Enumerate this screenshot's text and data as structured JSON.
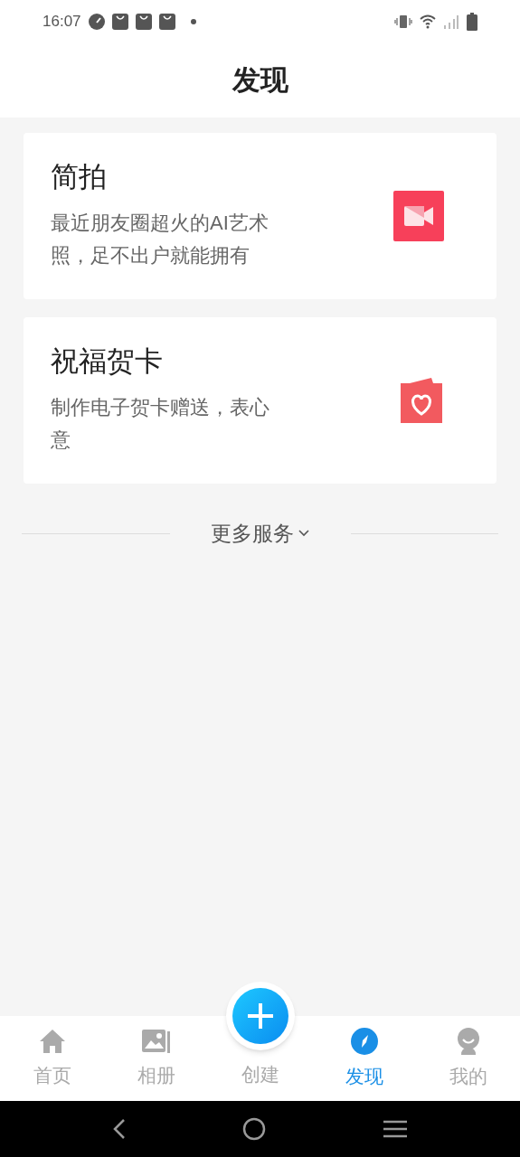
{
  "status_bar": {
    "time": "16:07"
  },
  "header": {
    "title": "发现"
  },
  "cards": [
    {
      "title": "简拍",
      "description_lines": [
        "最近朋友圈超火的AI艺术",
        "照，足不出户就能拥有"
      ],
      "kind": "camera"
    },
    {
      "title": "祝福贺卡",
      "description_lines": [
        "制作电子贺卡赠送，表心",
        "意"
      ],
      "kind": "card"
    }
  ],
  "more": {
    "label": "更多服务"
  },
  "tab_bar": [
    {
      "label": "首页",
      "kind": "home",
      "selected": false
    },
    {
      "label": "相册",
      "kind": "album",
      "selected": false
    },
    {
      "label": "创建",
      "kind": "create",
      "selected": false
    },
    {
      "label": "发现",
      "kind": "discover",
      "selected": true
    },
    {
      "label": "我的",
      "kind": "me",
      "selected": false
    }
  ]
}
